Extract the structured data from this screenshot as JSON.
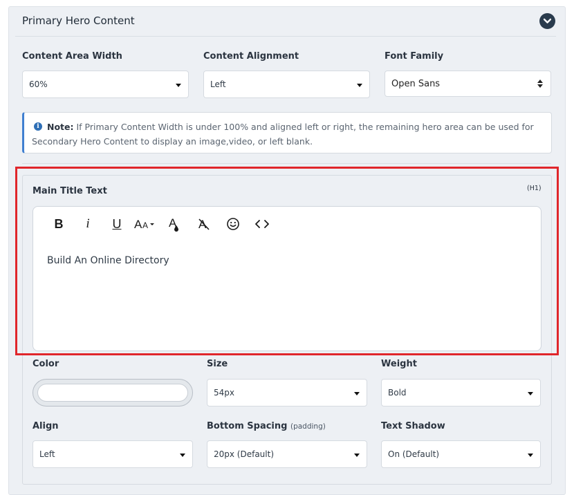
{
  "panel": {
    "title": "Primary Hero Content",
    "collapse_icon": "chevron-down-icon"
  },
  "top_fields": {
    "content_area_width": {
      "label": "Content Area Width",
      "value": "60%"
    },
    "content_alignment": {
      "label": "Content Alignment",
      "value": "Left"
    },
    "font_family": {
      "label": "Font Family",
      "value": "Open Sans"
    }
  },
  "note": {
    "icon": "info-icon",
    "strong": "Note:",
    "text": " If Primary Content Width is under 100% and aligned left or right, the remaining hero area can be used for Secondary Hero Content to display an image,video, or left blank."
  },
  "main_title": {
    "label": "Main Title Text",
    "tag": "(H1)",
    "content": "Build An Online Directory",
    "toolbar": [
      "bold-icon",
      "italic-icon",
      "underline-icon",
      "font-size-icon",
      "text-color-icon",
      "clear-format-icon",
      "emoji-icon",
      "code-view-icon"
    ]
  },
  "style_fields": {
    "color": {
      "label": "Color",
      "value": ""
    },
    "size": {
      "label": "Size",
      "value": "54px"
    },
    "weight": {
      "label": "Weight",
      "value": "Bold"
    },
    "align": {
      "label": "Align",
      "value": "Left"
    },
    "bottom_spacing": {
      "label": "Bottom Spacing",
      "sub": "(padding)",
      "value": "20px (Default)"
    },
    "text_shadow": {
      "label": "Text Shadow",
      "value": "On (Default)"
    }
  },
  "colors": {
    "highlight": "#e0262b",
    "note_accent": "#3f7fd0",
    "header_button": "#2a3b4d"
  }
}
